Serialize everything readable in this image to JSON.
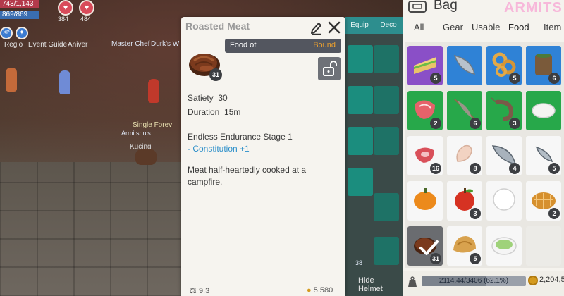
{
  "hud": {
    "hp_text": "743/1,143",
    "mp_text": "869/869",
    "btn1_count": "384",
    "btn2_count": "484",
    "exp_label": "XP",
    "region_label": "Regio",
    "event_guide": "Event Guide",
    "anniversary": "Aniver",
    "master_chef": "Master Chef",
    "durks": "Durk's W",
    "player_name": "Armitshu's",
    "player_title": "Single Forev",
    "pet_name": "Kucing"
  },
  "item_card": {
    "title": "Roasted Meat",
    "quantity": "31",
    "tag_label": "Food of",
    "tag_status": "Bound",
    "stats": [
      {
        "label": "Satiety",
        "value": "30"
      },
      {
        "label": "Duration",
        "value": "15m"
      }
    ],
    "effect_title": "Endless Endurance Stage 1",
    "effect_bonus": "- Constitution +1",
    "description": "Meat half-heartedly cooked at a campfire.",
    "footer_weight": "9.3",
    "footer_gold": "5,580"
  },
  "strip": {
    "tab_equip": "Equip",
    "tab_deco": "Deco",
    "hide_helmet": "Hide Helmet",
    "side_count": "38"
  },
  "bag": {
    "title": "Bag",
    "watermark": "ARMITS",
    "tabs": [
      "All",
      "Gear",
      "Usable",
      "Food",
      "Item"
    ],
    "active_tab": "Food",
    "slots": [
      {
        "icon": "sandwich-icon",
        "count": "5",
        "bg": "#8a4fc7"
      },
      {
        "icon": "fish-icon",
        "count": "",
        "bg": "#2f82d6"
      },
      {
        "icon": "onion-rings-icon",
        "count": "5",
        "bg": "#2f82d6"
      },
      {
        "icon": "drink-icon",
        "count": "6",
        "bg": "#2f82d6"
      },
      {
        "icon": "raw-meat-icon",
        "count": "2",
        "bg": "#27a84a"
      },
      {
        "icon": "fish-skewer-icon",
        "count": "6",
        "bg": "#27a84a"
      },
      {
        "icon": "shrimp-icon",
        "count": "3",
        "bg": "#27a84a"
      },
      {
        "icon": "rice-ball-icon",
        "count": "",
        "bg": "#27a84a"
      },
      {
        "icon": "steak-slice-icon",
        "count": "16",
        "bg": "#f7f7f7"
      },
      {
        "icon": "chicken-meat-icon",
        "count": "8",
        "bg": "#f7f7f7"
      },
      {
        "icon": "big-fish-icon",
        "count": "4",
        "bg": "#f7f7f7"
      },
      {
        "icon": "small-fish-icon",
        "count": "5",
        "bg": "#f7f7f7"
      },
      {
        "icon": "pumpkin-icon",
        "count": "",
        "bg": "#f7f7f7"
      },
      {
        "icon": "apple-icon",
        "count": "3",
        "bg": "#f7f7f7"
      },
      {
        "icon": "milk-icon",
        "count": "",
        "bg": "#f7f7f7"
      },
      {
        "icon": "pie-icon",
        "count": "2",
        "bg": "#f7f7f7"
      },
      {
        "icon": "roasted-meat-icon",
        "count": "31",
        "bg": "#6a6c70"
      },
      {
        "icon": "bread-icon",
        "count": "5",
        "bg": "#f7f7f7"
      },
      {
        "icon": "soup-icon",
        "count": "",
        "bg": "#f7f7f7"
      },
      {
        "icon": "empty-slot",
        "count": "",
        "bg": "#ecebe7"
      }
    ],
    "weight_text": "2114.44/3406 (62.1%)",
    "weight_fraction": 0.621,
    "gold_text": "2,204,5"
  }
}
